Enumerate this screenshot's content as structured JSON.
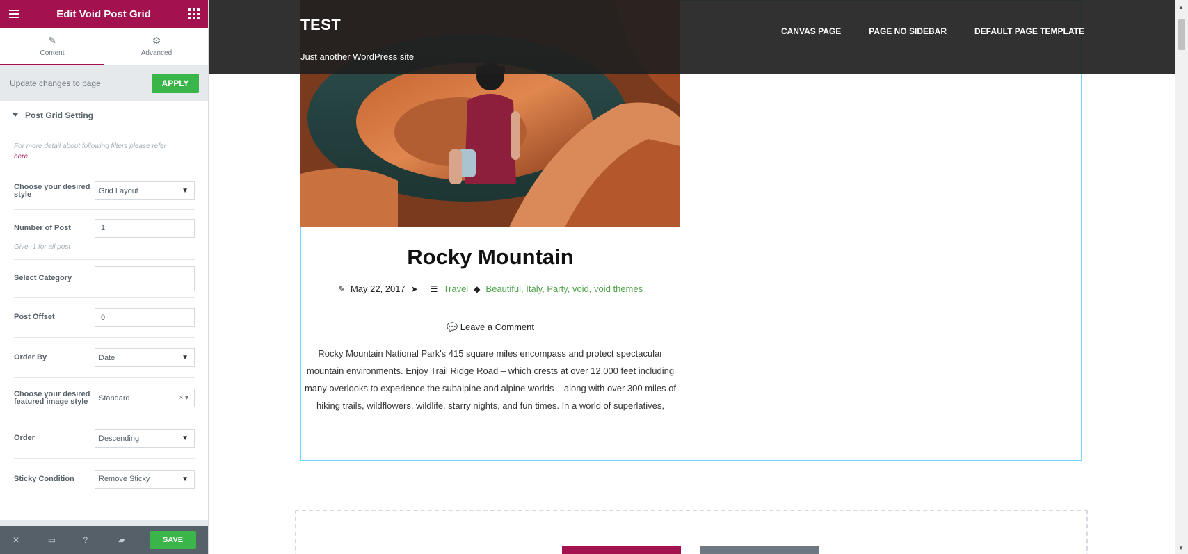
{
  "panel": {
    "title": "Edit Void Post Grid",
    "tabs": [
      {
        "label": "Content"
      },
      {
        "label": "Advanced"
      }
    ],
    "update_text": "Update changes to page",
    "apply_label": "APPLY",
    "section_title": "Post Grid Setting",
    "note_text": "For more detail about following filters please refer",
    "note_link": "here",
    "controls": {
      "style": {
        "label": "Choose your desired style",
        "value": "Grid Layout"
      },
      "number": {
        "label": "Number of Post",
        "value": "1",
        "hint": "Give -1 for all post"
      },
      "category": {
        "label": "Select Category",
        "value": ""
      },
      "offset": {
        "label": "Post Offset",
        "value": "0"
      },
      "order_by": {
        "label": "Order By",
        "value": "Date"
      },
      "image_style": {
        "label": "Choose your desired featured image style",
        "value": "Standard"
      },
      "order": {
        "label": "Order",
        "value": "Descending"
      },
      "sticky": {
        "label": "Sticky Condition",
        "value": "Remove Sticky"
      }
    },
    "footer": {
      "save_label": "SAVE"
    }
  },
  "site": {
    "title": "TEST",
    "tagline": "Just another WordPress site",
    "nav": [
      "CANVAS PAGE",
      "PAGE NO SIDEBAR",
      "DEFAULT PAGE TEMPLATE"
    ]
  },
  "post": {
    "title": "Rocky Mountain",
    "date": "May 22, 2017",
    "category": "Travel",
    "tags": "Beautiful, Italy, Party, void, void themes",
    "comment": "Leave a Comment",
    "excerpt": "Rocky Mountain National Park's 415 square miles encompass and protect spectacular mountain environments. Enjoy Trail Ridge Road – which crests at over 12,000 feet including many overlooks to experience the subalpine and alpine worlds – along with over 300 miles of hiking trails, wildflowers, wildlife, starry nights, and fun times. In a world of superlatives,"
  },
  "colors": {
    "brand": "#a4114f",
    "apply": "#39b54a",
    "link_green": "#4fa34b"
  }
}
